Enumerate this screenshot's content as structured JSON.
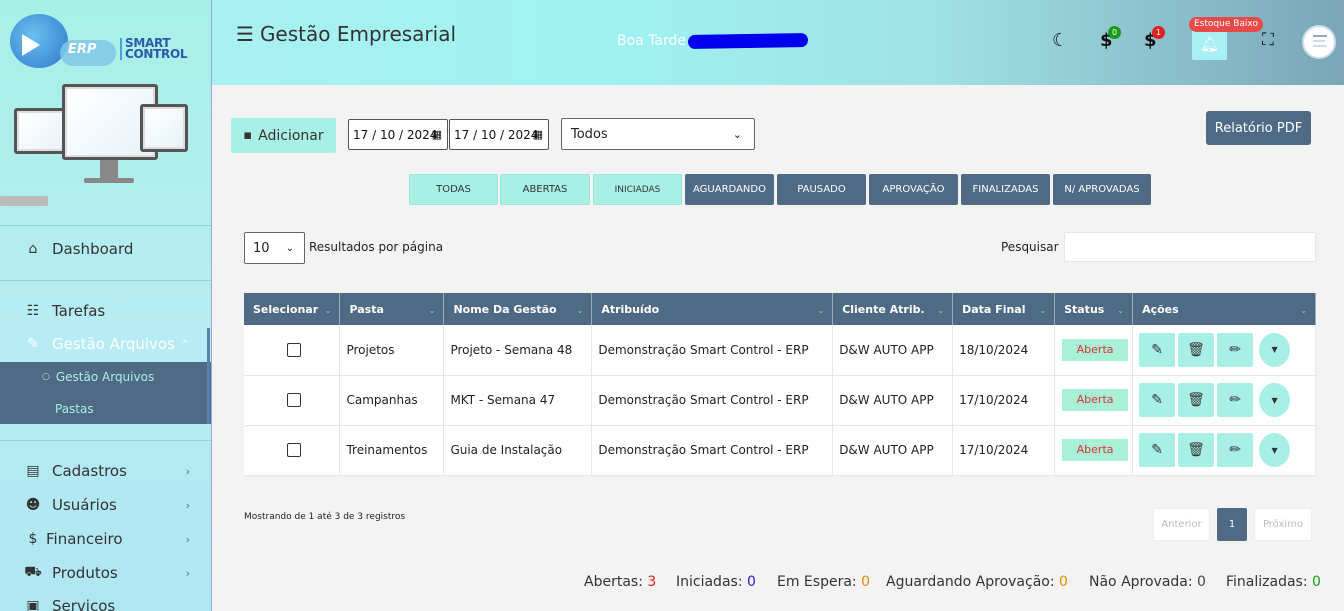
{
  "app": {
    "logo_erp": "ERP",
    "logo_smart": "SMART",
    "logo_control": "CONTROL"
  },
  "sidebar": {
    "items": [
      {
        "label": "Dashboard",
        "icon": "home-icon",
        "chevron": ""
      },
      {
        "label": "Tarefas",
        "icon": "checklist-icon",
        "chevron": ""
      },
      {
        "label": "Gestão Arquivos",
        "icon": "folder-edit-icon",
        "chevron": "⌃"
      },
      {
        "label": "Cadastros",
        "icon": "id-card-icon",
        "chevron": "›"
      },
      {
        "label": "Usuários",
        "icon": "users-icon",
        "chevron": "›"
      },
      {
        "label": "Financeiro",
        "icon": "dollar-icon",
        "chevron": "›"
      },
      {
        "label": "Produtos",
        "icon": "cart-icon",
        "chevron": "›"
      },
      {
        "label": "Serviços",
        "icon": "briefcase-icon",
        "chevron": ""
      }
    ],
    "submenu": [
      {
        "label": "Gestão Arquivos",
        "bullet": "○"
      },
      {
        "label": "Pastas",
        "bullet": ""
      }
    ]
  },
  "header": {
    "title": "Gestão Empresarial",
    "greeting": "Boa Tarde",
    "badge_green": "0",
    "badge_red": "1",
    "stock_alert": "Estoque Baixo",
    "colors": {
      "badge_green": "#1a9a1a",
      "badge_red": "#e02020"
    }
  },
  "toolbar": {
    "add_label": "Adicionar",
    "date_start": "17 / 10 / 2024",
    "date_end": "17 / 10 / 2024",
    "filter_select": "Todos",
    "pdf_label": "Relatório PDF"
  },
  "filters": [
    "TODAS",
    "ABERTAS",
    "INICIADAS",
    "AGUARDANDO",
    "PAUSADO",
    "APROVAÇÃO",
    "FINALIZADAS",
    "N/ APROVADAS"
  ],
  "listing": {
    "per_page_value": "10",
    "per_page_label": "Resultados por página",
    "search_label": "Pesquisar"
  },
  "table": {
    "columns": [
      "Selecionar",
      "Pasta",
      "Nome Da Gestão",
      "Atribuído",
      "Cliente Atrib.",
      "Data Final",
      "Status",
      "Ações"
    ],
    "rows": [
      {
        "pasta": "Projetos",
        "nome": "Projeto - Semana 48",
        "atribuido": "Demonstração Smart Control - ERP",
        "cliente": "D&W AUTO APP",
        "data": "18/10/2024",
        "status": "Aberta"
      },
      {
        "pasta": "Campanhas",
        "nome": "MKT - Semana 47",
        "atribuido": "Demonstração Smart Control - ERP",
        "cliente": "D&W AUTO APP",
        "data": "17/10/2024",
        "status": "Aberta"
      },
      {
        "pasta": "Treinamentos",
        "nome": "Guia de Instalação",
        "atribuido": "Demonstração Smart Control - ERP",
        "cliente": "D&W AUTO APP",
        "data": "17/10/2024",
        "status": "Aberta"
      }
    ]
  },
  "pagination": {
    "showing": "Mostrando de 1 até 3 de 3 registros",
    "prev": "Anterior",
    "current": "1",
    "next": "Próximo"
  },
  "summary": {
    "abertas_label": "Abertas:",
    "abertas": "3",
    "iniciadas_label": "Iniciadas:",
    "iniciadas": "0",
    "espera_label": "Em Espera:",
    "espera": "0",
    "aguardando_label": "Aguardando Aprovação:",
    "aguardando": "0",
    "nao_aprovada_label": "Não Aprovada:",
    "nao_aprovada": "0",
    "finalizadas_label": "Finalizadas:",
    "finalizadas": "0"
  }
}
